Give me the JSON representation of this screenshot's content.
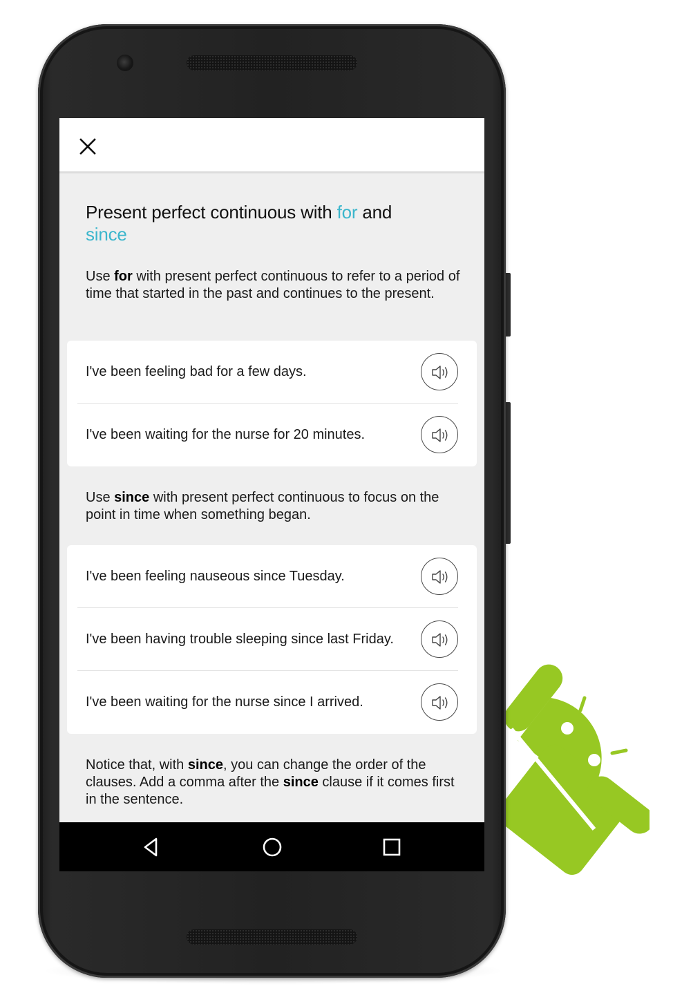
{
  "lesson": {
    "title_before": "Present perfect continuous with ",
    "title_hl1": "for",
    "title_mid": " and",
    "title_hl2": "since",
    "accent_color": "#3bb6cc"
  },
  "intro_for": {
    "pre": "Use ",
    "keyword": "for",
    "post": " with present perfect continuous to refer to a period of time that started in the past and continues to the present."
  },
  "examples_for": [
    {
      "text": "I've been feeling bad for a few days.",
      "audio_icon": "speaker-icon"
    },
    {
      "text": "I've been waiting for the nurse for 20 minutes.",
      "audio_icon": "speaker-icon"
    }
  ],
  "intro_since": {
    "pre": "Use ",
    "keyword": "since",
    "post": " with present perfect continuous to focus on the point in time when something began."
  },
  "examples_since": [
    {
      "text": "I've been feeling nauseous since Tuesday.",
      "audio_icon": "speaker-icon"
    },
    {
      "text": "I've been having trouble sleeping since last Friday.",
      "audio_icon": "speaker-icon"
    },
    {
      "text": "I've been waiting for the nurse since I arrived.",
      "audio_icon": "speaker-icon"
    }
  ],
  "note": {
    "pre": "Notice that, with ",
    "kw1": "since",
    "mid": ", you can change the order of the clauses. Add a comma after the ",
    "kw2": "since",
    "post": " clause if it comes first in the sentence."
  },
  "icons": {
    "close": "close-icon",
    "back": "back-triangle-icon",
    "home": "home-circle-icon",
    "recent": "recent-apps-square-icon",
    "mascot": "android-robot-icon"
  },
  "colors": {
    "android_green": "#97c823",
    "phone_body": "#222222",
    "screen_bg": "#efefef"
  }
}
